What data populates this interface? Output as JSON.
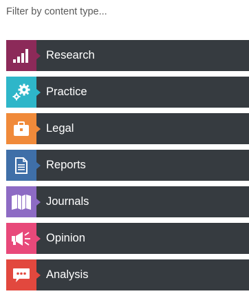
{
  "heading": "Filter by content type...",
  "items": [
    {
      "label": "Research",
      "color": "#8c2a59",
      "icon": "bar-chart-icon"
    },
    {
      "label": "Practice",
      "color": "#2eb6c9",
      "icon": "gears-icon"
    },
    {
      "label": "Legal",
      "color": "#f08a3a",
      "icon": "briefcase-icon"
    },
    {
      "label": "Reports",
      "color": "#3f6fa8",
      "icon": "document-icon"
    },
    {
      "label": "Journals",
      "color": "#8d6bc4",
      "icon": "open-book-icon"
    },
    {
      "label": "Opinion",
      "color": "#e8497a",
      "icon": "megaphone-icon"
    },
    {
      "label": "Analysis",
      "color": "#e2483e",
      "icon": "speech-bubble-icon"
    }
  ]
}
